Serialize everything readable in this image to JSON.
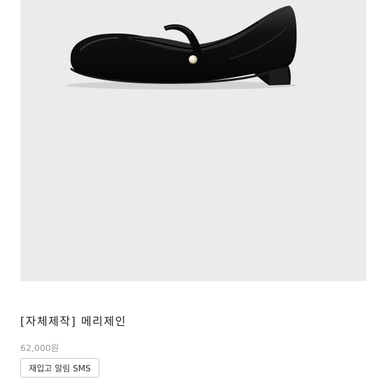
{
  "product": {
    "image_icon": "mary-jane-shoe-photo",
    "title": "[자체제작] 메리제인",
    "price": "62,000원",
    "restock_button_label": "재입고 알림 SMS"
  },
  "colors": {
    "image_background": "#ebebeb",
    "shoe": "#111111",
    "price_text": "#9a9a9a",
    "button_border": "#c8c8c8"
  }
}
